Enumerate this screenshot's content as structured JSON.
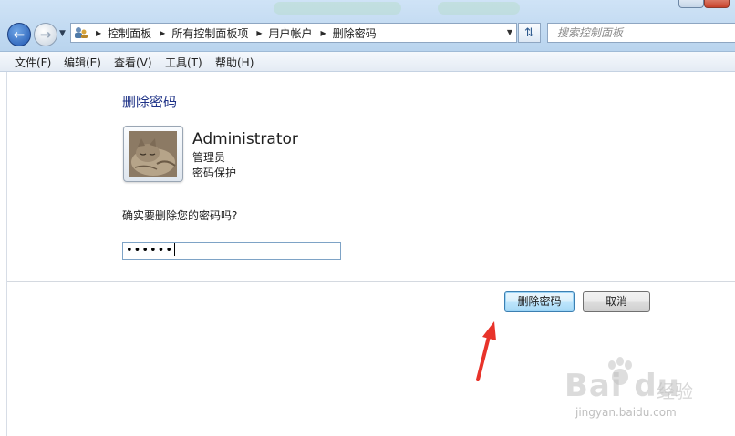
{
  "address_bar": {
    "breadcrumbs": [
      "控制面板",
      "所有控制面板项",
      "用户帐户",
      "删除密码"
    ],
    "search_placeholder": "搜索控制面板"
  },
  "menu": {
    "items": [
      "文件(F)",
      "编辑(E)",
      "查看(V)",
      "工具(T)",
      "帮助(H)"
    ]
  },
  "page": {
    "title": "删除密码",
    "user": {
      "name": "Administrator",
      "role": "管理员",
      "status": "密码保护"
    },
    "question": "确实要删除您的密码吗?",
    "password_value": "••••••"
  },
  "buttons": {
    "confirm": "删除密码",
    "cancel": "取消"
  },
  "watermark": {
    "brand": "Bai du",
    "sub": "经验",
    "url": "jingyan.baidu.com"
  },
  "colors": {
    "heading": "#1e3287",
    "annotation_arrow": "#e8332a"
  },
  "icons": {
    "back": "back-arrow-icon",
    "forward": "forward-arrow-icon",
    "control_panel": "control-panel-icon",
    "refresh": "refresh-icon",
    "avatar": "cat-avatar"
  }
}
